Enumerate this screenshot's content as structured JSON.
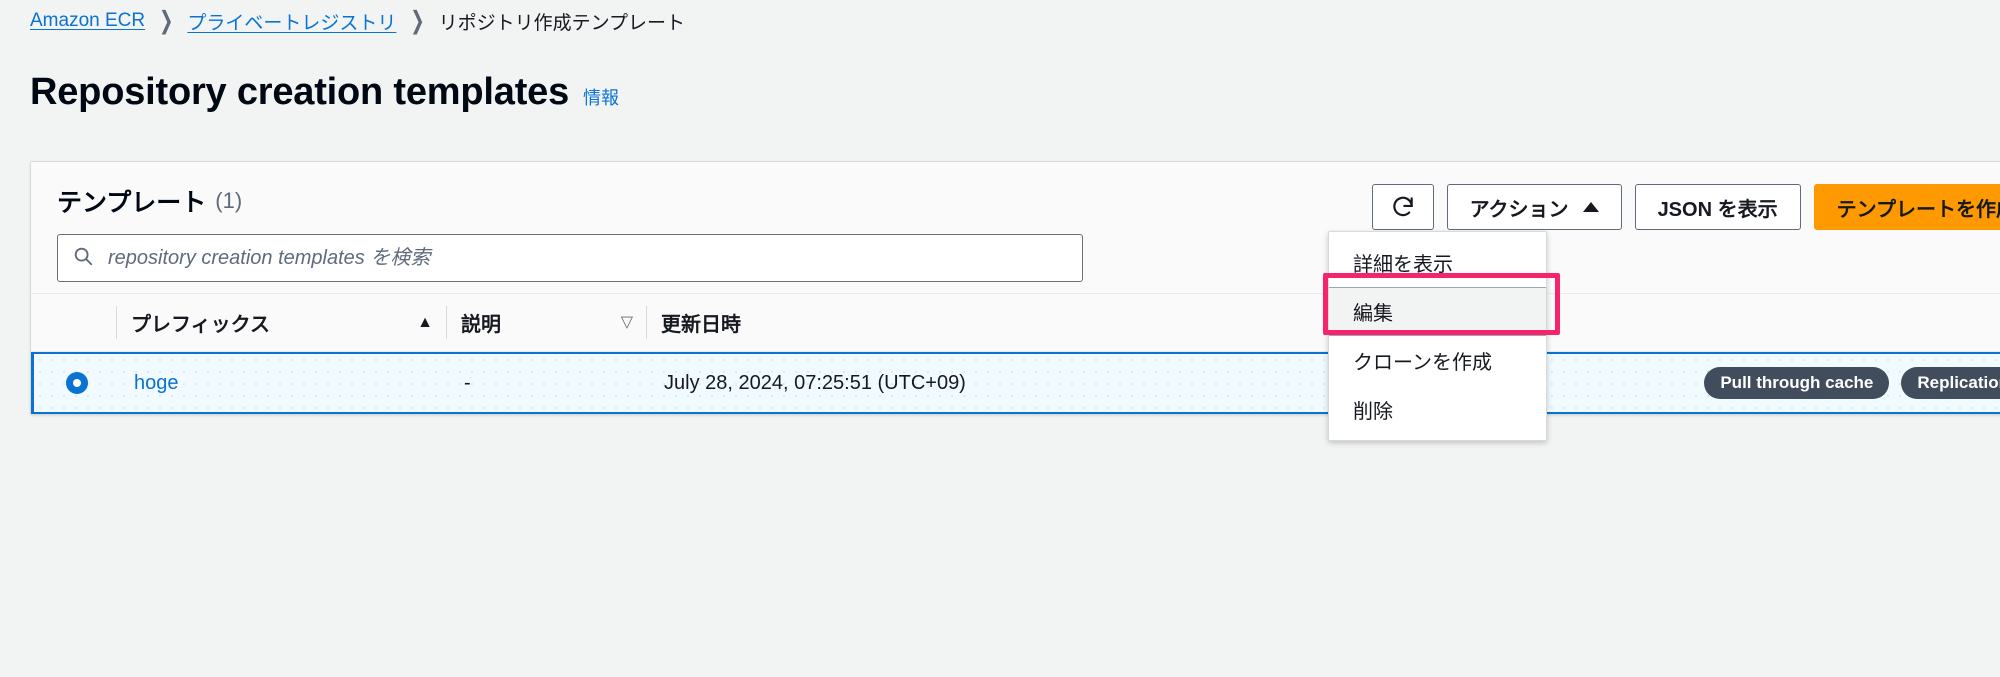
{
  "breadcrumb": {
    "items": [
      {
        "label": "Amazon ECR",
        "link": true
      },
      {
        "label": "プライベートレジストリ",
        "link": true
      },
      {
        "label": "リポジトリ作成テンプレート",
        "link": false
      }
    ],
    "separator": "❯"
  },
  "page": {
    "title": "Repository creation templates",
    "info_label": "情報"
  },
  "card": {
    "title": "テンプレート",
    "count": "(1)"
  },
  "toolbar": {
    "refresh_icon": "refresh-icon",
    "actions_label": "アクション",
    "actions_caret": "caret-up-icon",
    "view_json_label": "JSON を表示",
    "create_template_label": "テンプレートを作成"
  },
  "search": {
    "icon": "search-icon",
    "placeholder": "repository creation templates を検索",
    "value": ""
  },
  "table": {
    "columns": [
      {
        "key": "select",
        "label": "",
        "sort": ""
      },
      {
        "key": "prefix",
        "label": "プレフィックス",
        "sort": "▲"
      },
      {
        "key": "description",
        "label": "説明",
        "sort": "▽"
      },
      {
        "key": "updated",
        "label": "更新日時",
        "sort": ""
      },
      {
        "key": "applied",
        "label": "",
        "sort": ""
      }
    ],
    "rows": [
      {
        "selected": true,
        "prefix": "hoge",
        "description": "-",
        "updated": "July 28, 2024, 07:25:51 (UTC+09)",
        "badges": [
          "Pull through cache",
          "Replication"
        ]
      }
    ]
  },
  "dropdown": {
    "open": true,
    "items": [
      {
        "label": "詳細を表示",
        "hovered": false
      },
      {
        "label": "編集",
        "hovered": true
      },
      {
        "label": "クローンを作成",
        "hovered": false
      },
      {
        "label": "削除",
        "hovered": false
      }
    ]
  },
  "colors": {
    "link": "#0972d3",
    "primary_button": "#ff9900",
    "annotation": "#f5246b",
    "badge": "#414d5c",
    "page_background": "#f2f3f3",
    "selected_row": "#f1faff"
  }
}
